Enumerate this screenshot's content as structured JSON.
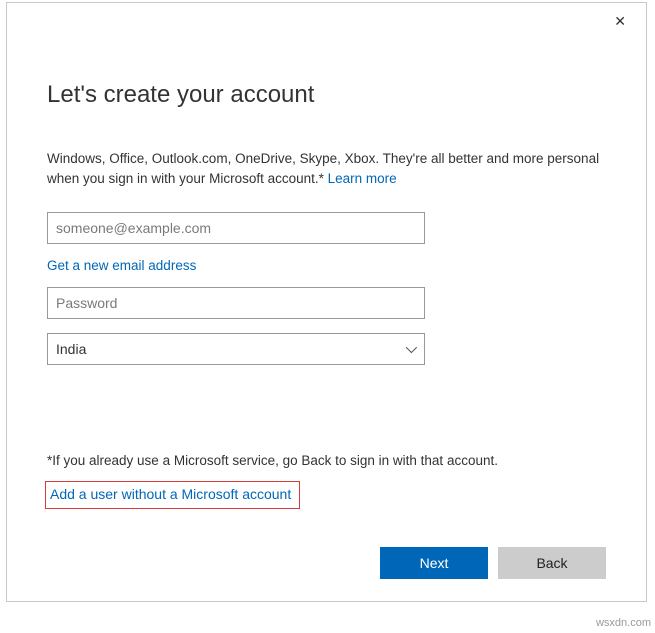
{
  "close_label": "✕",
  "title": "Let's create your account",
  "description_text": "Windows, Office, Outlook.com, OneDrive, Skype, Xbox. They're all better and more personal when you sign in with your Microsoft account.* ",
  "learn_more": "Learn more",
  "email_placeholder": "someone@example.com",
  "get_email_link": "Get a new email address",
  "password_placeholder": "Password",
  "country_selected": "India",
  "footer_note": "*If you already use a Microsoft service, go Back to sign in with that account.",
  "add_user_link": "Add a user without a Microsoft account",
  "buttons": {
    "next": "Next",
    "back": "Back"
  },
  "watermark": "wsxdn.com"
}
